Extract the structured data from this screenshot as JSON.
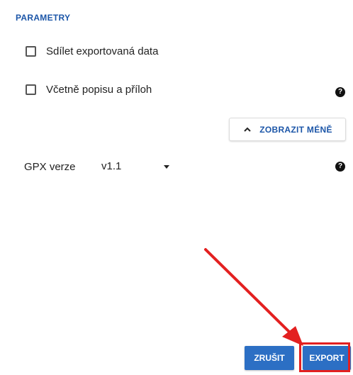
{
  "section": {
    "title": "PARAMETRY"
  },
  "options": [
    {
      "label": "Sdílet exportovaná data",
      "checked": false
    },
    {
      "label": "Včetně popisu a příloh",
      "checked": false
    }
  ],
  "toggle": {
    "label": "ZOBRAZIT MÉNĚ",
    "icon": "chevron-up-icon"
  },
  "gpx": {
    "label": "GPX verze",
    "selected": "v1.1"
  },
  "help_icon": {
    "glyph": "?"
  },
  "footer": {
    "cancel_label": "ZRUŠIT",
    "export_label": "EXPORT"
  },
  "colors": {
    "accent": "#2c6fc4",
    "title": "#1c56a8",
    "annotation": "#e32020"
  }
}
